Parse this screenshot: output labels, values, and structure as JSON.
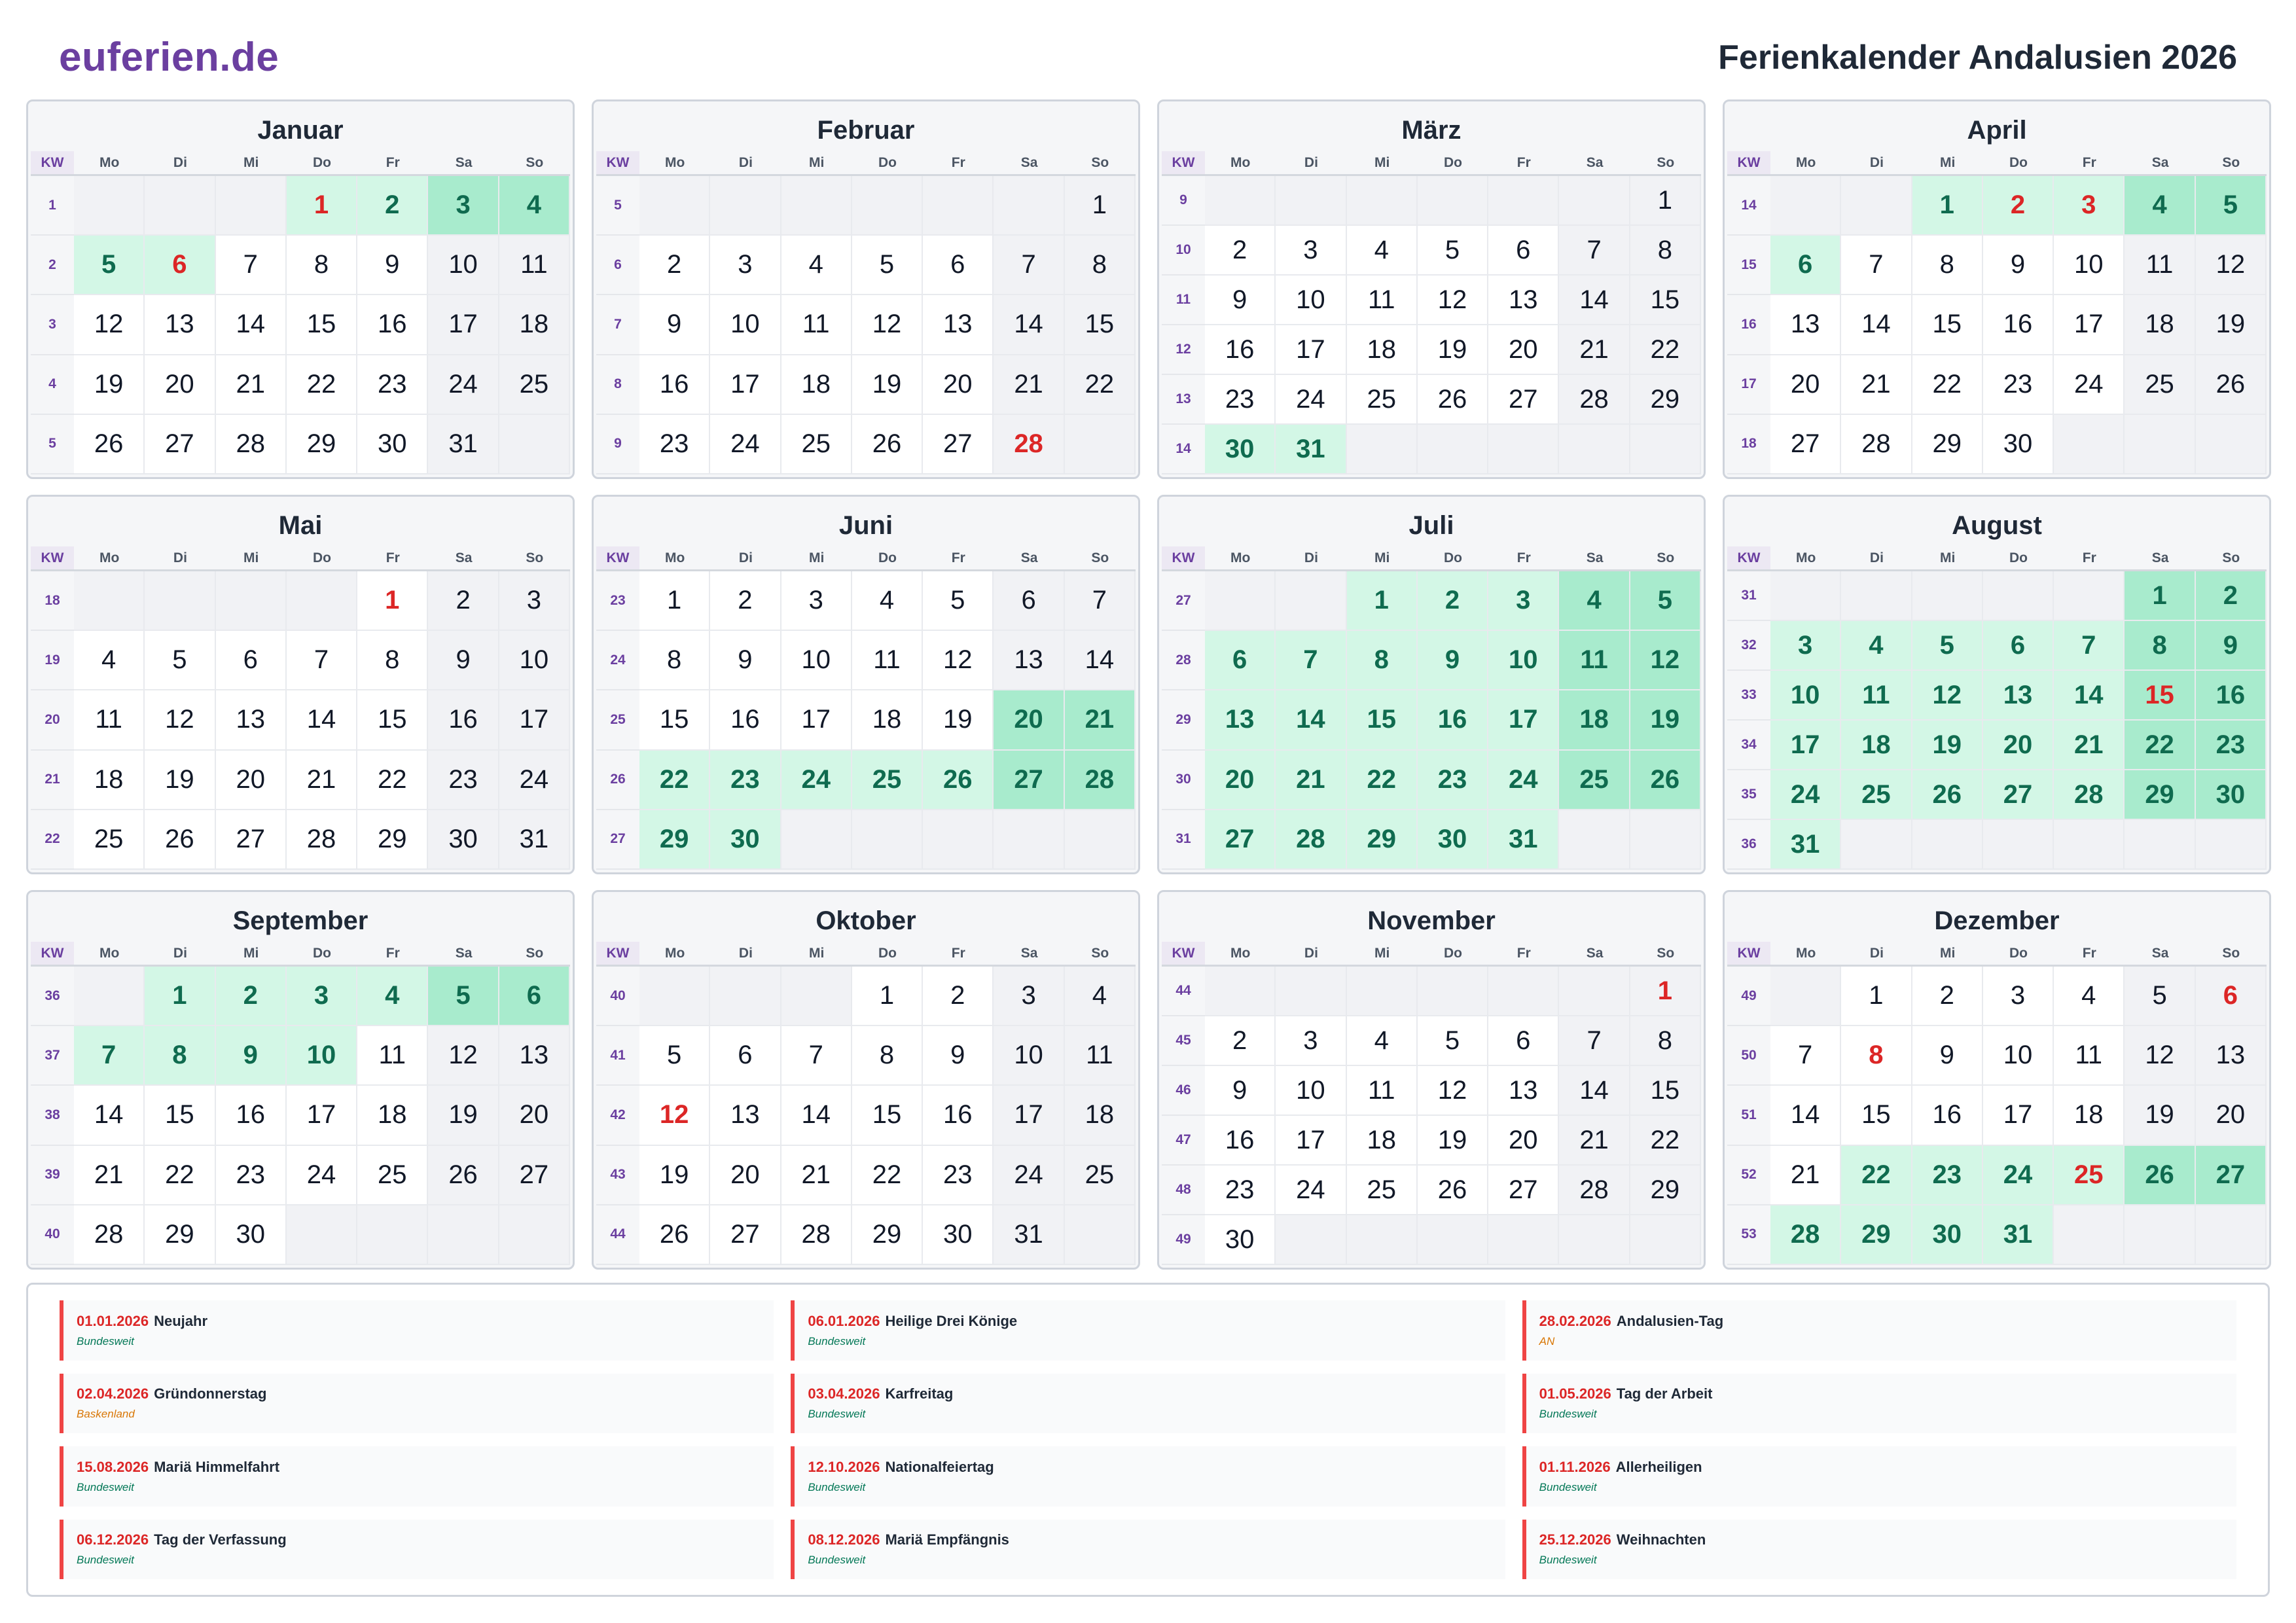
{
  "header": {
    "logo": "euferien.de",
    "title": "Ferienkalender Andalusien 2026"
  },
  "kw_label": "KW",
  "weekdays": [
    "Mo",
    "Di",
    "Mi",
    "Do",
    "Fr",
    "Sa",
    "So"
  ],
  "colors": {
    "holiday_red": "#dc2626",
    "ferien_green": "#d3f7e6",
    "ferien_weekend_green": "#a8ebcd",
    "brand_purple": "#6b3fa0"
  },
  "months": [
    {
      "name": "Januar",
      "start": 3,
      "days": 31,
      "kw": [
        1,
        2,
        3,
        4,
        5
      ],
      "ferien": [
        1,
        2,
        3,
        4,
        5,
        6
      ],
      "holidays": [
        1,
        6
      ]
    },
    {
      "name": "Februar",
      "start": 6,
      "days": 28,
      "kw": [
        5,
        6,
        7,
        8,
        9
      ],
      "ferien": [],
      "holidays": [
        28
      ]
    },
    {
      "name": "März",
      "start": 6,
      "days": 31,
      "kw": [
        9,
        10,
        11,
        12,
        13,
        14
      ],
      "ferien": [
        30,
        31
      ],
      "holidays": []
    },
    {
      "name": "April",
      "start": 2,
      "days": 30,
      "kw": [
        14,
        15,
        16,
        17,
        18
      ],
      "ferien": [
        1,
        2,
        3,
        4,
        5,
        6
      ],
      "holidays": [
        2,
        3
      ]
    },
    {
      "name": "Mai",
      "start": 4,
      "days": 31,
      "kw": [
        18,
        19,
        20,
        21,
        22
      ],
      "ferien": [],
      "holidays": [
        1
      ]
    },
    {
      "name": "Juni",
      "start": 0,
      "days": 30,
      "kw": [
        23,
        24,
        25,
        26,
        27
      ],
      "ferien": [
        20,
        21,
        22,
        23,
        24,
        25,
        26,
        27,
        28,
        29,
        30
      ],
      "holidays": []
    },
    {
      "name": "Juli",
      "start": 2,
      "days": 31,
      "kw": [
        27,
        28,
        29,
        30,
        31
      ],
      "ferien": [
        1,
        2,
        3,
        4,
        5,
        6,
        7,
        8,
        9,
        10,
        11,
        12,
        13,
        14,
        15,
        16,
        17,
        18,
        19,
        20,
        21,
        22,
        23,
        24,
        25,
        26,
        27,
        28,
        29,
        30,
        31
      ],
      "holidays": []
    },
    {
      "name": "August",
      "start": 5,
      "days": 31,
      "kw": [
        31,
        32,
        33,
        34,
        35,
        36
      ],
      "ferien": [
        1,
        2,
        3,
        4,
        5,
        6,
        7,
        8,
        9,
        10,
        11,
        12,
        13,
        14,
        15,
        16,
        17,
        18,
        19,
        20,
        21,
        22,
        23,
        24,
        25,
        26,
        27,
        28,
        29,
        30,
        31
      ],
      "holidays": [
        15
      ]
    },
    {
      "name": "September",
      "start": 1,
      "days": 30,
      "kw": [
        36,
        37,
        38,
        39,
        40
      ],
      "ferien": [
        1,
        2,
        3,
        4,
        5,
        6,
        7,
        8,
        9,
        10
      ],
      "holidays": []
    },
    {
      "name": "Oktober",
      "start": 3,
      "days": 31,
      "kw": [
        40,
        41,
        42,
        43,
        44
      ],
      "ferien": [],
      "holidays": [
        12
      ]
    },
    {
      "name": "November",
      "start": 6,
      "days": 30,
      "kw": [
        44,
        45,
        46,
        47,
        48,
        49
      ],
      "ferien": [],
      "holidays": [
        1
      ]
    },
    {
      "name": "Dezember",
      "start": 1,
      "days": 31,
      "kw": [
        49,
        50,
        51,
        52,
        53
      ],
      "ferien": [
        22,
        23,
        24,
        25,
        26,
        27,
        28,
        29,
        30,
        31
      ],
      "holidays": [
        6,
        8,
        25
      ]
    }
  ],
  "legend": [
    {
      "date": "01.01.2026",
      "name": "Neujahr",
      "region": "Bundesweit"
    },
    {
      "date": "06.01.2026",
      "name": "Heilige Drei Könige",
      "region": "Bundesweit"
    },
    {
      "date": "28.02.2026",
      "name": "Andalusien-Tag",
      "region": "AN"
    },
    {
      "date": "02.04.2026",
      "name": "Gründonnerstag",
      "region": "Baskenland"
    },
    {
      "date": "03.04.2026",
      "name": "Karfreitag",
      "region": "Bundesweit"
    },
    {
      "date": "01.05.2026",
      "name": "Tag der Arbeit",
      "region": "Bundesweit"
    },
    {
      "date": "15.08.2026",
      "name": "Mariä Himmelfahrt",
      "region": "Bundesweit"
    },
    {
      "date": "12.10.2026",
      "name": "Nationalfeiertag",
      "region": "Bundesweit"
    },
    {
      "date": "01.11.2026",
      "name": "Allerheiligen",
      "region": "Bundesweit"
    },
    {
      "date": "06.12.2026",
      "name": "Tag der Verfassung",
      "region": "Bundesweit"
    },
    {
      "date": "08.12.2026",
      "name": "Mariä Empfängnis",
      "region": "Bundesweit"
    },
    {
      "date": "25.12.2026",
      "name": "Weihnachten",
      "region": "Bundesweit"
    }
  ]
}
